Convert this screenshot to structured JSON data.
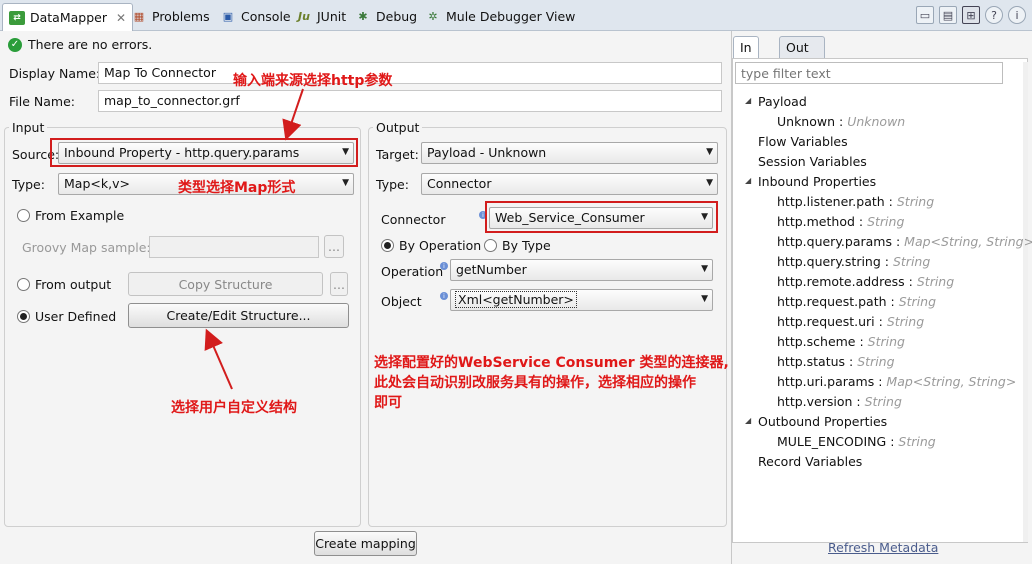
{
  "tabs": [
    {
      "label": "DataMapper",
      "icon": "datamapper-icon",
      "active": true
    },
    {
      "label": "Problems",
      "icon": "problems-icon"
    },
    {
      "label": "Console",
      "icon": "console-icon"
    },
    {
      "label": "JUnit",
      "icon": "junit-icon"
    },
    {
      "label": "Debug",
      "icon": "debug-icon"
    },
    {
      "label": "Mule Debugger View",
      "icon": "mule-debugger-icon"
    }
  ],
  "status": {
    "message": "There are no errors.",
    "icon": "check-icon"
  },
  "form": {
    "display_name_label": "Display Name:",
    "display_name_value": "Map To Connector",
    "file_name_label": "File Name:",
    "file_name_value": "map_to_connector.grf"
  },
  "input": {
    "title": "Input",
    "source_label": "Source:",
    "source_value": "Inbound Property - http.query.params",
    "type_label": "Type:",
    "type_value": "Map<k,v>",
    "from_example_label": "From Example",
    "groovy_label": "Groovy Map sample:",
    "browse_label": "...",
    "from_output_label": "From output",
    "copy_structure_label": "Copy Structure",
    "copy_browse_label": "...",
    "user_defined_label": "User Defined",
    "create_edit_label": "Create/Edit Structure..."
  },
  "output": {
    "title": "Output",
    "target_label": "Target:",
    "target_value": "Payload - Unknown",
    "type_label": "Type:",
    "type_value": "Connector",
    "connector_label": "Connector",
    "connector_value": "Web_Service_Consumer",
    "by_operation_label": "By Operation",
    "by_type_label": "By Type",
    "operation_label": "Operation",
    "operation_value": "getNumber",
    "object_label": "Object",
    "object_value": "Xml<getNumber>"
  },
  "create_mapping_label": "Create mapping",
  "annotations": {
    "source_note": "输入端来源选择http参数",
    "type_note": "类型选择Map形式",
    "user_defined_note": "选择用户自定义结构",
    "connector_note_1": "选择配置好的WebService Consumer 类型的连接器,",
    "connector_note_2": "此处会自动识别改服务具有的操作，选择相应的操作",
    "connector_note_3": "即可"
  },
  "right_panel": {
    "tab_in": "In",
    "tab_out": "Out",
    "filter_placeholder": "type filter text",
    "tree": [
      {
        "label": "Payload",
        "type": "",
        "level": 0,
        "expanded": true
      },
      {
        "label": "Unknown",
        "type": "Unknown",
        "level": 1
      },
      {
        "label": "Flow Variables",
        "type": "",
        "level": 0
      },
      {
        "label": "Session Variables",
        "type": "",
        "level": 0
      },
      {
        "label": "Inbound Properties",
        "type": "",
        "level": 0,
        "expanded": true
      },
      {
        "label": "http.listener.path",
        "type": "String",
        "level": 1
      },
      {
        "label": "http.method",
        "type": "String",
        "level": 1
      },
      {
        "label": "http.query.params",
        "type": "Map<String, String>",
        "level": 1
      },
      {
        "label": "http.query.string",
        "type": "String",
        "level": 1
      },
      {
        "label": "http.remote.address",
        "type": "String",
        "level": 1
      },
      {
        "label": "http.request.path",
        "type": "String",
        "level": 1
      },
      {
        "label": "http.request.uri",
        "type": "String",
        "level": 1
      },
      {
        "label": "http.scheme",
        "type": "String",
        "level": 1
      },
      {
        "label": "http.status",
        "type": "String",
        "level": 1
      },
      {
        "label": "http.uri.params",
        "type": "Map<String, String>",
        "level": 1
      },
      {
        "label": "http.version",
        "type": "String",
        "level": 1
      },
      {
        "label": "Outbound Properties",
        "type": "",
        "level": 0,
        "expanded": true
      },
      {
        "label": "MULE_ENCODING",
        "type": "String",
        "level": 1
      },
      {
        "label": "Record Variables",
        "type": "",
        "level": 0
      }
    ],
    "refresh_label": "Refresh Metadata"
  },
  "colors": {
    "annotation": "#e01818",
    "highlight_border": "#d21d1d",
    "success": "#2a9d3a"
  }
}
